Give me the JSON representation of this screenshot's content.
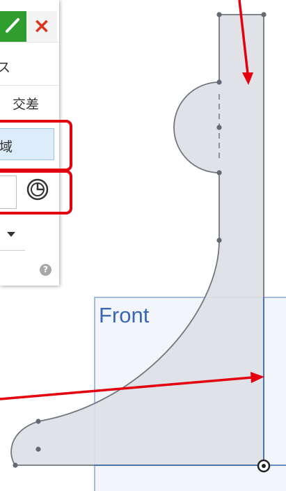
{
  "panel": {
    "ok_icon": "checkmark-icon",
    "cancel_icon": "close-icon",
    "cancel_label": "×",
    "row1_text": "ス",
    "row2_text": "交差",
    "region_field_value": "域",
    "clock_icon": "clock-icon",
    "dropdown_icon": "chevron-down-icon",
    "help_icon": "help-icon",
    "help_label": "?"
  },
  "viewport": {
    "plane_label": "Front",
    "origin_icon": "origin-icon"
  },
  "colors": {
    "confirm_green": "#2f9e2f",
    "cancel_red": "#d9371b",
    "highlight_red": "#e3000f",
    "selected_field_blue": "#dcecfa",
    "sketch_fill": "#dde0e5",
    "plane_blue": "#3a68b5"
  }
}
